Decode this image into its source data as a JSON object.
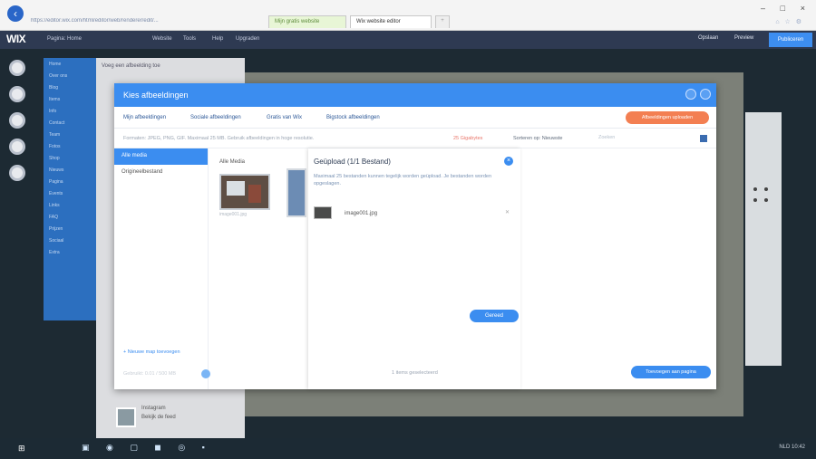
{
  "browser": {
    "address": "https://editor.wix.com/html/editor/web/renderer/edit/...",
    "tabs": [
      "Mijn gratis website",
      "Wix website editor"
    ],
    "window_controls": [
      "–",
      "□",
      "×"
    ]
  },
  "wix_bar": {
    "logo": "WIX",
    "site_name": "Pagina: Home",
    "menu": [
      "Website",
      "Tools",
      "Help",
      "Upgraden"
    ],
    "right_items": [
      "Opslaan",
      "Preview"
    ],
    "publish": "Publiceren"
  },
  "editor": {
    "nav_items": [
      "Home",
      "Over ons",
      "Blog",
      "Items",
      "Info",
      "Contact",
      "Team",
      "Fotos",
      "Shop",
      "Nieuws",
      "Pagina",
      "Events",
      "Links",
      "FAQ",
      "Prijzen",
      "Sociaal",
      "Extra"
    ],
    "canvas_label": "Voeg een afbeelding toe",
    "card_title": "Instagram",
    "card_sub": "Bekijk de feed"
  },
  "modal": {
    "title": "Kies afbeeldingen",
    "tabs": [
      "Mijn afbeeldingen",
      "Sociale afbeeldingen",
      "Gratis van Wix",
      "Bigstock afbeeldingen"
    ],
    "upload_button": "Afbeeldingen uploaden",
    "info": "Formaten: JPEG, PNG, GIF. Maximaal 25 MB. Gebruik afbeeldingen in hoge resolutie.",
    "info_link": "25 Gigabytes",
    "sort": "Sorteren op: Nieuwste",
    "search_placeholder": "Zoeken",
    "folders": [
      "Alle mediа",
      "Origineelbestand"
    ],
    "new_folder": "+ Nieuwe map toevoegen",
    "storage": "Gebruikt: 0.01 / 500 MB",
    "media_title": "Alle Media",
    "thumb_caption": "image001.jpg",
    "upload_panel": {
      "title": "Geüpload (1/1 Bestand)",
      "note": "Maximaal 25 bestanden kunnen tegelijk worden geüpload. Je bestanden worden opgeslagen.",
      "file_name": "image001.jpg",
      "done": "Gereed"
    },
    "footer_center": "1 items geselecteerd",
    "add_button": "Toevoegen aan pagina"
  },
  "taskbar": {
    "start": "⊞",
    "tray": "NLD 10:42"
  }
}
